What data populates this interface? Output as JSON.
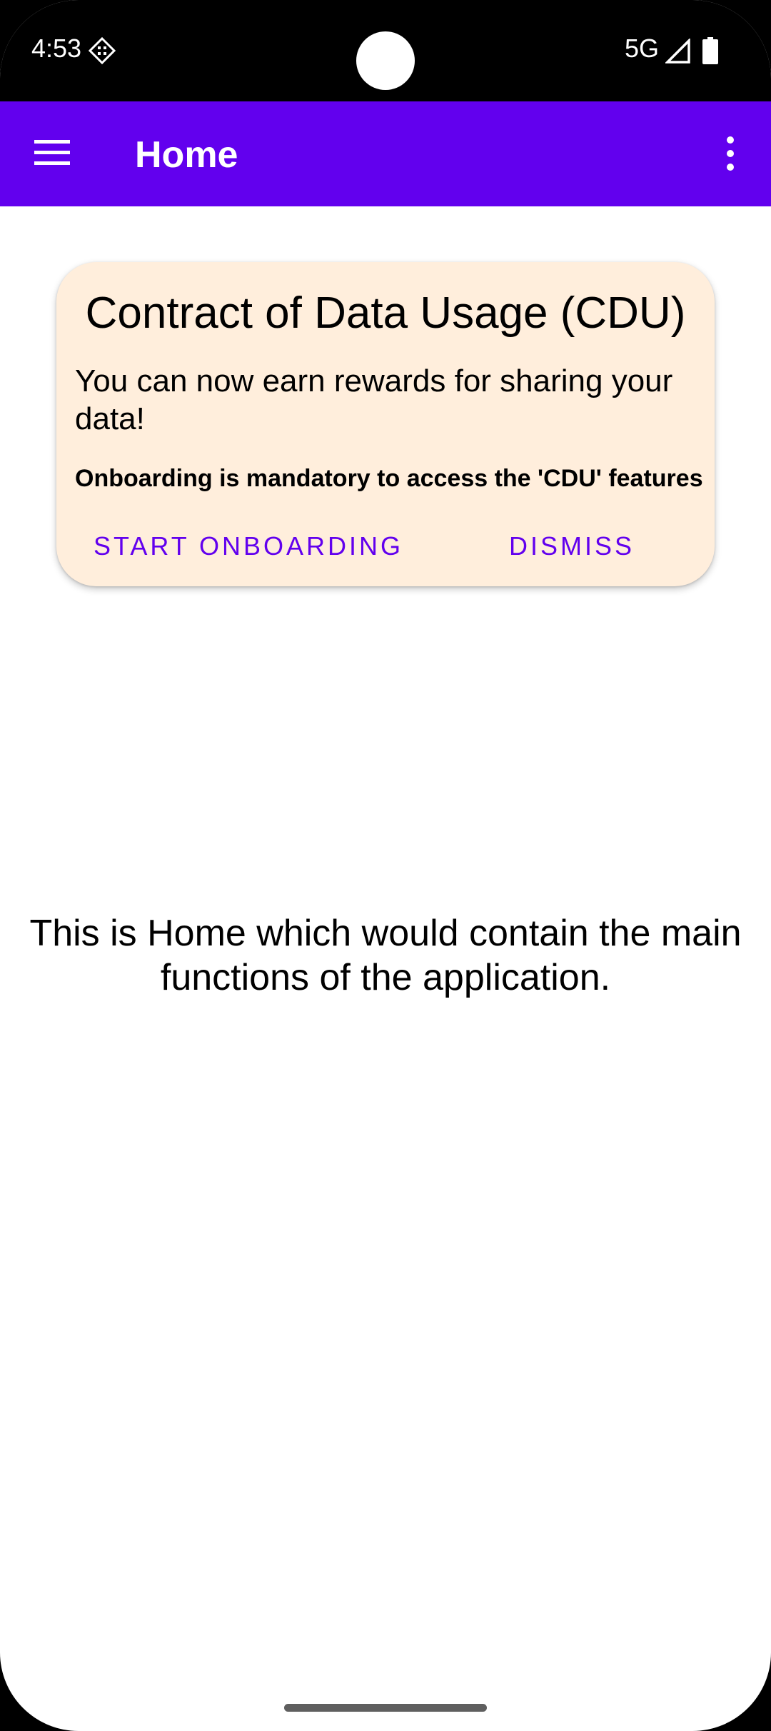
{
  "status_bar": {
    "time": "4:53",
    "network": "5G",
    "icons": [
      "diamond-notification-icon",
      "signal-icon",
      "battery-icon"
    ]
  },
  "app_bar": {
    "title": "Home",
    "background": "#6200ee",
    "icons": [
      "menu-icon",
      "overflow-menu-icon"
    ]
  },
  "cdu_card": {
    "title": "Contract of Data Usage (CDU)",
    "body": "You can now earn rewards for sharing your data!",
    "note": "Onboarding is mandatory to access the 'CDU' features",
    "start_onboarding_label": "START ONBOARDING",
    "dismiss_label": "DISMISS",
    "background": "#ffeedc",
    "accent": "#6200ee"
  },
  "main": {
    "text": "This is Home which would contain the main functions of the application."
  }
}
